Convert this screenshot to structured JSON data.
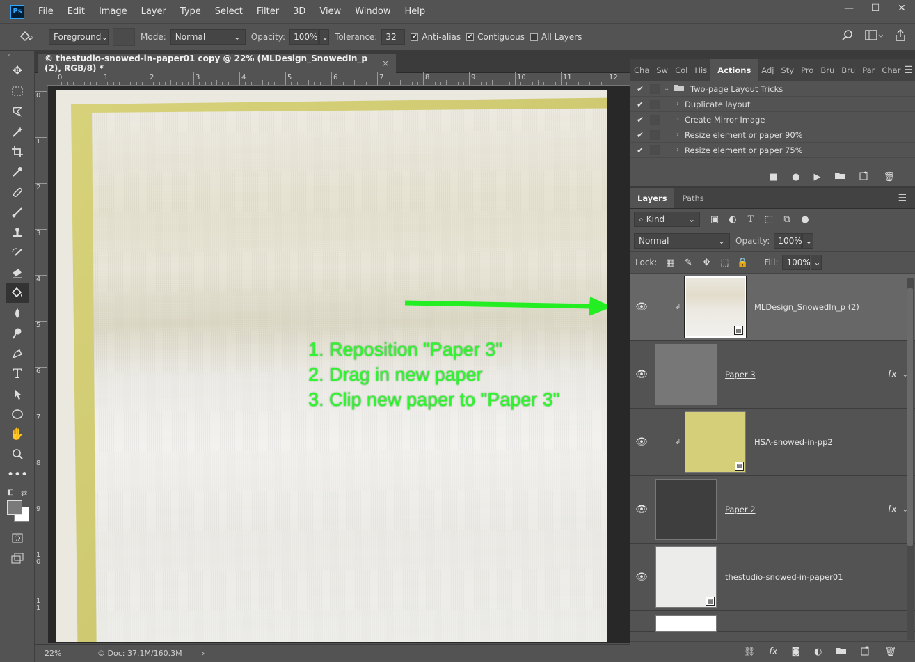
{
  "menubar": {
    "logo": "Ps",
    "items": [
      "File",
      "Edit",
      "Image",
      "Layer",
      "Type",
      "Select",
      "Filter",
      "3D",
      "View",
      "Window",
      "Help"
    ],
    "window_controls": [
      "—",
      "☐",
      "✕"
    ]
  },
  "options": {
    "fill_source": "Foreground",
    "mode_label": "Mode:",
    "mode_value": "Normal",
    "opacity_label": "Opacity:",
    "opacity_value": "100%",
    "tolerance_label": "Tolerance:",
    "tolerance_value": "32",
    "anti_alias": "Anti-alias",
    "contiguous": "Contiguous",
    "all_layers": "All Layers",
    "anti_alias_checked": true,
    "contiguous_checked": true,
    "all_layers_checked": false
  },
  "document": {
    "tab_title": "© thestudio-snowed-in-paper01 copy @ 22% (MLDesign_SnowedIn_p (2), RGB/8) *",
    "tab_close": "×",
    "ruler_h": [
      "0",
      "1",
      "2",
      "3",
      "4",
      "5",
      "6",
      "7",
      "8",
      "9",
      "10",
      "11",
      "12"
    ],
    "ruler_v": [
      "0",
      "1",
      "2",
      "3",
      "4",
      "5",
      "6",
      "7",
      "8",
      "9",
      "1 0",
      "1 1"
    ],
    "instructions": [
      "1. Reposition \"Paper 3\"",
      "2. Drag in new paper",
      "3. Clip new paper to \"Paper 3\""
    ],
    "arrow_color": "#22ee22"
  },
  "status": {
    "zoom": "22%",
    "doc_info": "© Doc: 37.1M/160.3M",
    "arrow": "›"
  },
  "actions_panel": {
    "tabs": [
      "Cha",
      "Sw",
      "Col",
      "His",
      "Actions",
      "Adj",
      "Sty",
      "Pro",
      "Bru",
      "Bru",
      "Par",
      "Char"
    ],
    "active_tab": "Actions",
    "set_name": "Two-page Layout Tricks",
    "items": [
      "Duplicate layout",
      "Create Mirror Image",
      "Resize element or paper 90%",
      "Resize element or paper 75%"
    ]
  },
  "layers_panel": {
    "tabs": [
      "Layers",
      "Paths"
    ],
    "filter_kind": "Kind",
    "blend_mode": "Normal",
    "opacity_label": "Opacity:",
    "opacity_value": "100%",
    "lock_label": "Lock:",
    "fill_label": "Fill:",
    "fill_value": "100%",
    "layers": [
      {
        "name": "MLDesign_SnowedIn_p (2)",
        "clipped": true,
        "selected": true,
        "fx": false
      },
      {
        "name": "Paper 3",
        "clipped": false,
        "selected": false,
        "fx": true
      },
      {
        "name": "HSA-snowed-in-pp2",
        "clipped": true,
        "selected": false,
        "fx": false
      },
      {
        "name": "Paper 2",
        "clipped": false,
        "selected": false,
        "fx": true
      },
      {
        "name": "thestudio-snowed-in-paper01",
        "clipped": false,
        "selected": false,
        "fx": false
      }
    ],
    "fx_symbol": "fx"
  }
}
